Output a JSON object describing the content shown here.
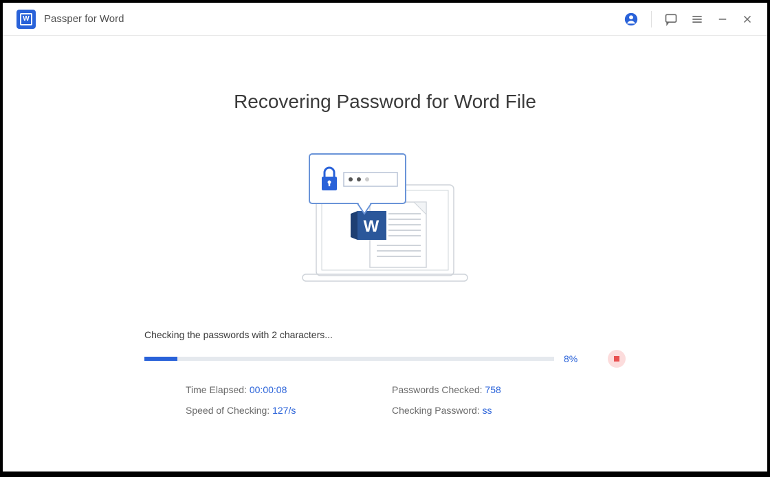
{
  "app": {
    "title": "Passper for Word"
  },
  "main": {
    "heading": "Recovering Password for Word File",
    "status_text": "Checking the passwords with 2 characters...",
    "progress_percent_label": "8%",
    "progress_percent_value": 8
  },
  "stats": {
    "time_elapsed_label": "Time Elapsed: ",
    "time_elapsed_value": "00:00:08",
    "speed_label": "Speed of Checking: ",
    "speed_value": "127/s",
    "passwords_checked_label": "Passwords Checked: ",
    "passwords_checked_value": "758",
    "checking_password_label": "Checking Password: ",
    "checking_password_value": "ss"
  }
}
